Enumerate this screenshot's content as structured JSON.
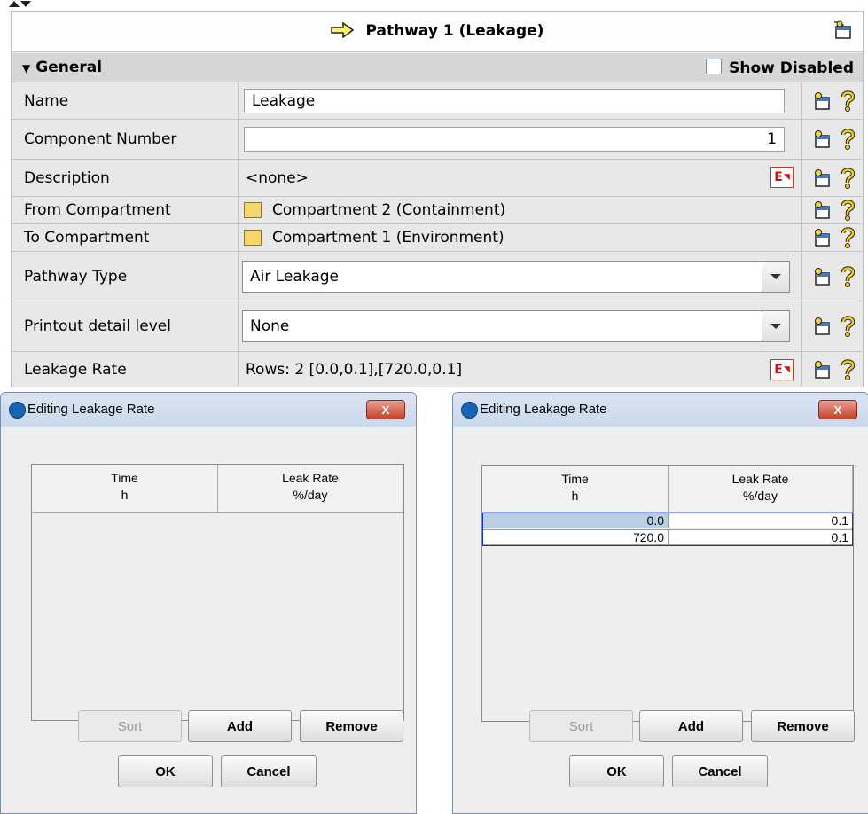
{
  "panel": {
    "title": "Pathway 1 (Leakage)",
    "section_label": "General",
    "show_disabled_label": "Show Disabled",
    "rows": [
      {
        "label": "Name",
        "value": "Leakage"
      },
      {
        "label": "Component Number",
        "value": "1"
      },
      {
        "label": "Description",
        "value": "<none>"
      },
      {
        "label": "From Compartment",
        "value": "Compartment 2 (Containment)"
      },
      {
        "label": "To Compartment",
        "value": "Compartment 1 (Environment)"
      },
      {
        "label": "Pathway Type",
        "value": "Air Leakage"
      },
      {
        "label": "Printout detail level",
        "value": "None"
      },
      {
        "label": "Leakage Rate",
        "value": "Rows: 2 [0.0,0.1],[720.0,0.1]"
      }
    ],
    "edit_button_label": "E"
  },
  "dialogs": [
    {
      "title": "Editing Leakage Rate",
      "close_label": "X",
      "columns": [
        {
          "name": "Time",
          "unit": "h"
        },
        {
          "name": "Leak Rate",
          "unit": "%/day"
        }
      ],
      "rows": [],
      "buttons": {
        "sort": "Sort",
        "add": "Add",
        "remove": "Remove",
        "ok": "OK",
        "cancel": "Cancel"
      }
    },
    {
      "title": "Editing Leakage Rate",
      "close_label": "X",
      "columns": [
        {
          "name": "Time",
          "unit": "h"
        },
        {
          "name": "Leak Rate",
          "unit": "%/day"
        }
      ],
      "rows": [
        {
          "time": "0.0",
          "rate": "0.1"
        },
        {
          "time": "720.0",
          "rate": "0.1"
        }
      ],
      "buttons": {
        "sort": "Sort",
        "add": "Add",
        "remove": "Remove",
        "ok": "OK",
        "cancel": "Cancel"
      }
    }
  ],
  "colors": {
    "swatch": "#f5d76e",
    "selection": "#b8cfe5",
    "selection_border": "#1a2fd0"
  }
}
